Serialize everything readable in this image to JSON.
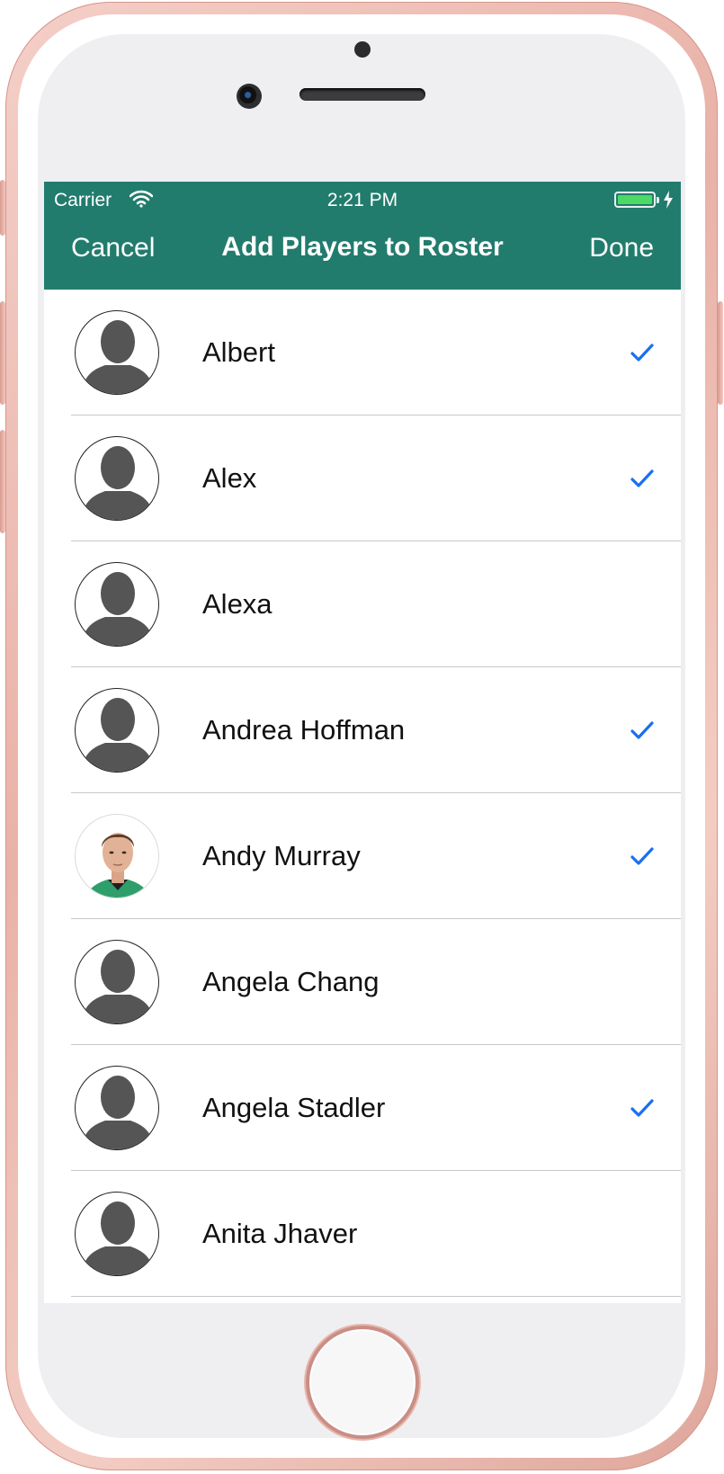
{
  "status_bar": {
    "carrier": "Carrier",
    "time": "2:21 PM",
    "wifi_icon": "wifi-icon",
    "battery_icon": "battery-charging-icon"
  },
  "nav": {
    "cancel_label": "Cancel",
    "title": "Add Players to Roster",
    "done_label": "Done"
  },
  "colors": {
    "nav_background": "#227c6d",
    "checkmark": "#1a6ff2",
    "battery": "#4cd964"
  },
  "players": [
    {
      "name": "Albert",
      "selected": true,
      "avatar": "person-silhouette-icon"
    },
    {
      "name": "Alex",
      "selected": true,
      "avatar": "person-silhouette-icon"
    },
    {
      "name": "Alexa",
      "selected": false,
      "avatar": "person-silhouette-icon"
    },
    {
      "name": "Andrea Hoffman",
      "selected": true,
      "avatar": "person-silhouette-icon"
    },
    {
      "name": "Andy Murray",
      "selected": true,
      "avatar": "profile-photo"
    },
    {
      "name": "Angela Chang",
      "selected": false,
      "avatar": "person-silhouette-icon"
    },
    {
      "name": "Angela Stadler",
      "selected": true,
      "avatar": "person-silhouette-icon"
    },
    {
      "name": "Anita Jhaver",
      "selected": false,
      "avatar": "person-silhouette-icon"
    }
  ]
}
